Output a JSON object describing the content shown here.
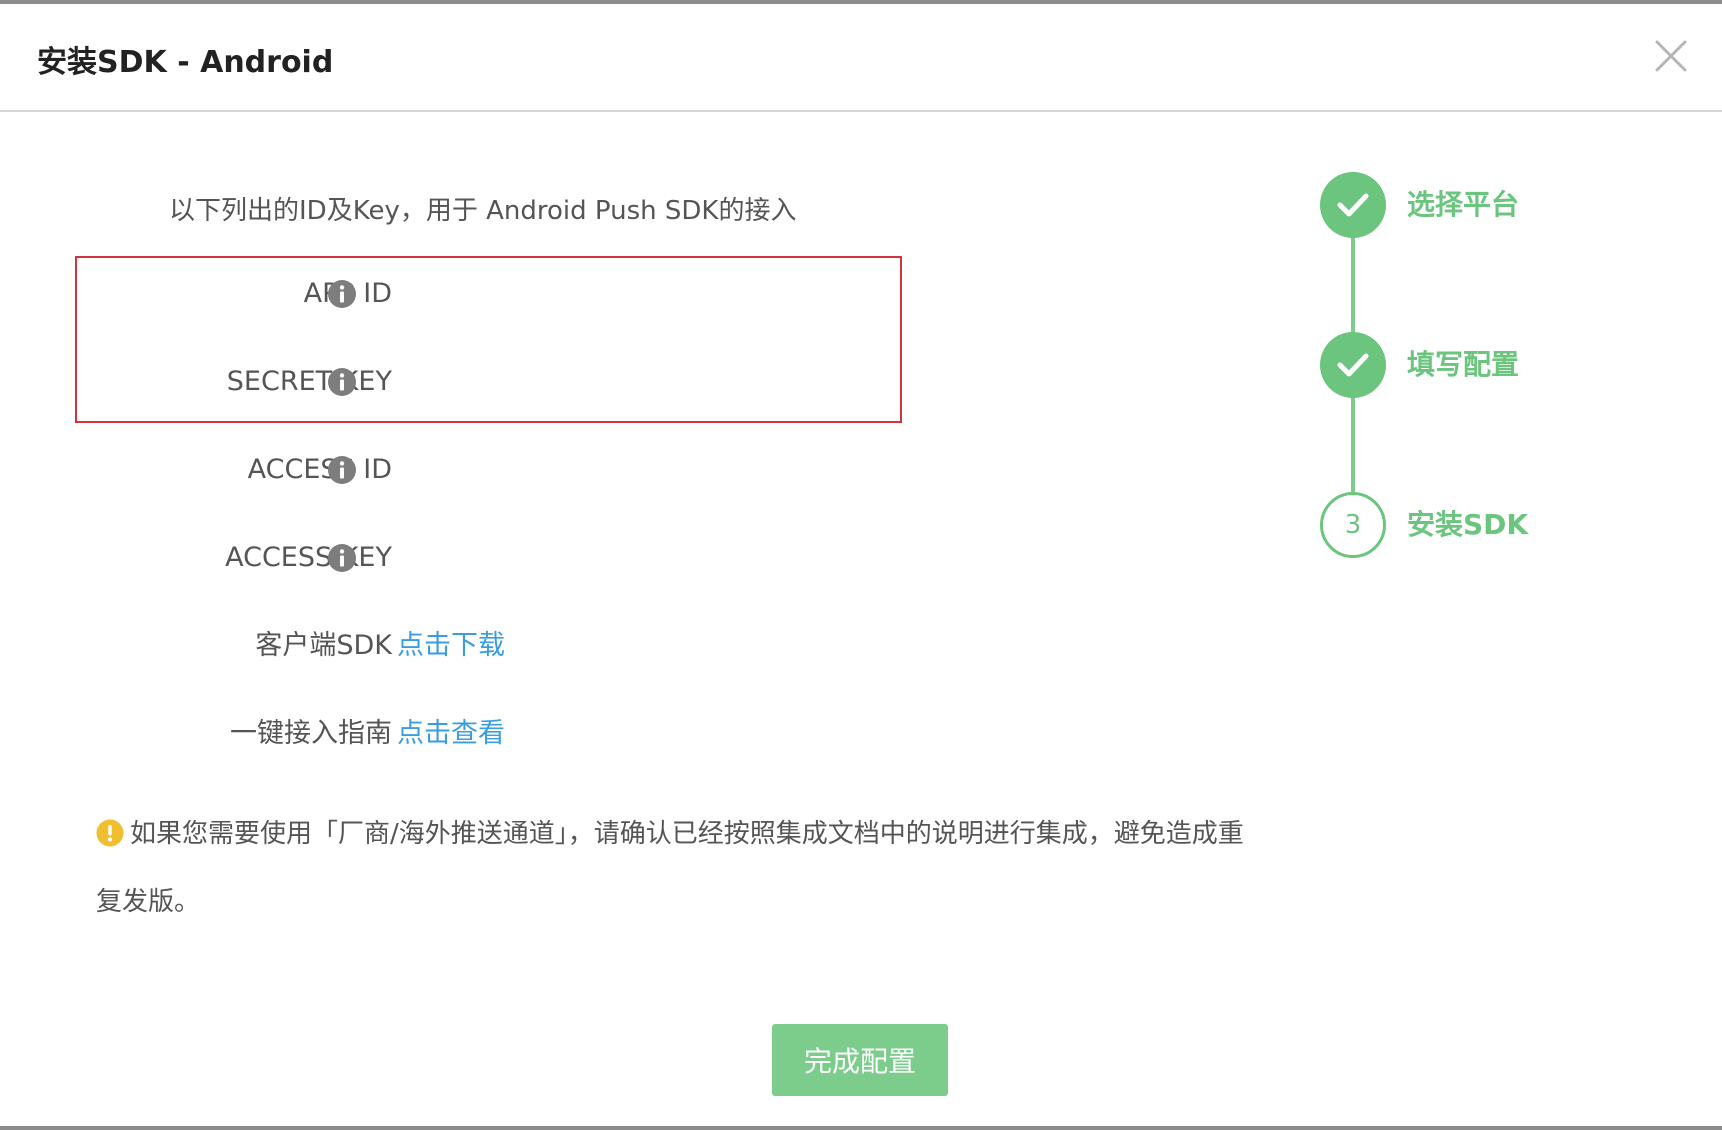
{
  "dialog": {
    "title": "安装SDK - Android"
  },
  "intro_text": "以下列出的ID及Key，用于 Android Push SDK的接入",
  "fields": {
    "app_id_label": "APP ID",
    "secret_key_label": "SECRET KEY",
    "access_id_label": "ACCESS ID",
    "access_key_label": "ACCESS KEY",
    "client_sdk_label": "客户端SDK",
    "client_sdk_link": "点击下载",
    "guide_label": "一键接入指南",
    "guide_link": "点击查看"
  },
  "notice": {
    "text": "如果您需要使用「厂商/海外推送通道」，请确认已经按照集成文档中的说明进行集成，避免造成重复发版。"
  },
  "steps": [
    {
      "label": "选择平台",
      "status": "done"
    },
    {
      "label": "填写配置",
      "status": "done"
    },
    {
      "number": "3",
      "label": "安装SDK",
      "status": "current"
    }
  ],
  "footer": {
    "finish_label": "完成配置"
  },
  "colors": {
    "accent_green": "#6cc57e",
    "button_green": "#7ccc8c",
    "link_blue": "#3a9de0",
    "highlight_red": "#d0343c",
    "warning_yellow": "#f0be2e"
  },
  "icons": {
    "close": "close-icon",
    "info": "info-icon",
    "warning": "warning-icon",
    "check": "checkmark-icon"
  }
}
